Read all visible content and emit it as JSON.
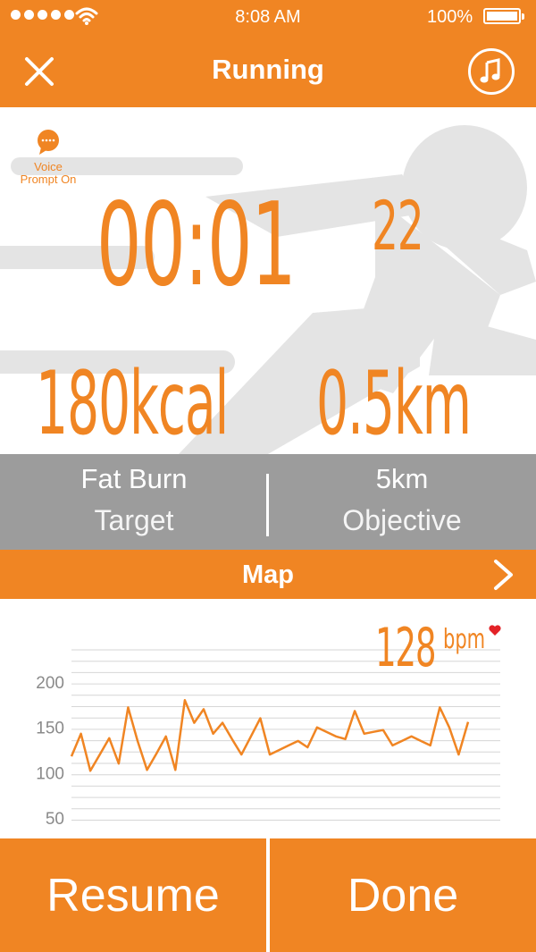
{
  "status_bar": {
    "time": "8:08 AM",
    "battery": "100%",
    "signal_bars": 5
  },
  "nav": {
    "title": "Running"
  },
  "voice": {
    "line1": "Voice",
    "line2": "Prompt On"
  },
  "workout": {
    "timer_main": "00:01",
    "timer_sub": "22",
    "calories": "180kcal",
    "distance": "0.5km"
  },
  "info": {
    "target_value": "Fat Burn",
    "target_label": "Target",
    "objective_value": "5km",
    "objective_label": "Objective"
  },
  "map_bar": {
    "label": "Map"
  },
  "heart_rate": {
    "value": "128",
    "unit": "bpm"
  },
  "chart_data": {
    "type": "line",
    "yticks": [
      "200",
      "150",
      "100",
      "50"
    ],
    "ylim": [
      50,
      200
    ],
    "series": [
      {
        "values": [
          118,
          143,
          102,
          120,
          138,
          110,
          172,
          135,
          103,
          121,
          140,
          103,
          180,
          155,
          170,
          143,
          155,
          137,
          120,
          140,
          160,
          120,
          125,
          130,
          135,
          128,
          150,
          145,
          140,
          137,
          168,
          143,
          145,
          147,
          130,
          135,
          140,
          135,
          130,
          172,
          150,
          120,
          156
        ]
      }
    ],
    "grid": true
  },
  "colors": {
    "accent": "#F08523",
    "gray_bar": "#9C9C9C",
    "heart": "#E32227",
    "silhouette": "#E4E4E4"
  },
  "buttons": {
    "resume": "Resume",
    "done": "Done"
  }
}
